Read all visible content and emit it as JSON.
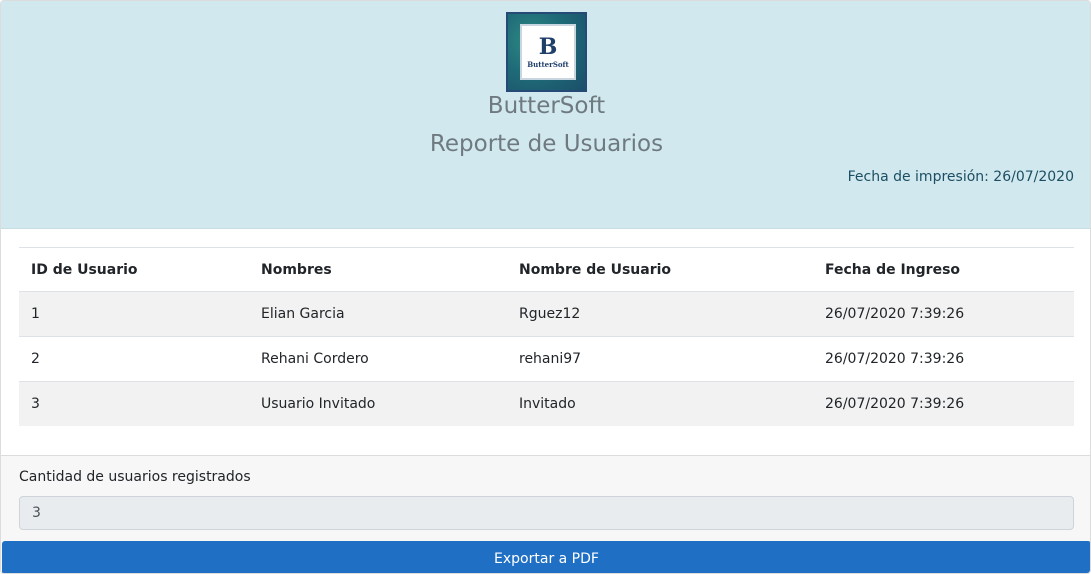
{
  "brand": {
    "logo_letter": "B",
    "logo_word": "ButterSoft",
    "company_name": "ButterSoft",
    "colors": {
      "header_bg": "#d1e9ee",
      "button_bg": "#1f6fc5",
      "logo_navy": "#1f3f6b"
    }
  },
  "report": {
    "title": "Reporte de Usuarios",
    "print_date": "Fecha de impresión: 26/07/2020"
  },
  "table": {
    "headers": [
      "ID de Usuario",
      "Nombres",
      "Nombre de Usuario",
      "Fecha de Ingreso"
    ],
    "rows": [
      [
        "1",
        "Elian Garcia",
        "Rguez12",
        "26/07/2020 7:39:26"
      ],
      [
        "2",
        "Rehani Cordero",
        "rehani97",
        "26/07/2020 7:39:26"
      ],
      [
        "3",
        "Usuario Invitado",
        "Invitado",
        "26/07/2020 7:39:26"
      ]
    ]
  },
  "summary": {
    "count_label": "Cantidad de usuarios registrados",
    "count_value": "3"
  },
  "actions": {
    "export_label": "Exportar a PDF"
  }
}
